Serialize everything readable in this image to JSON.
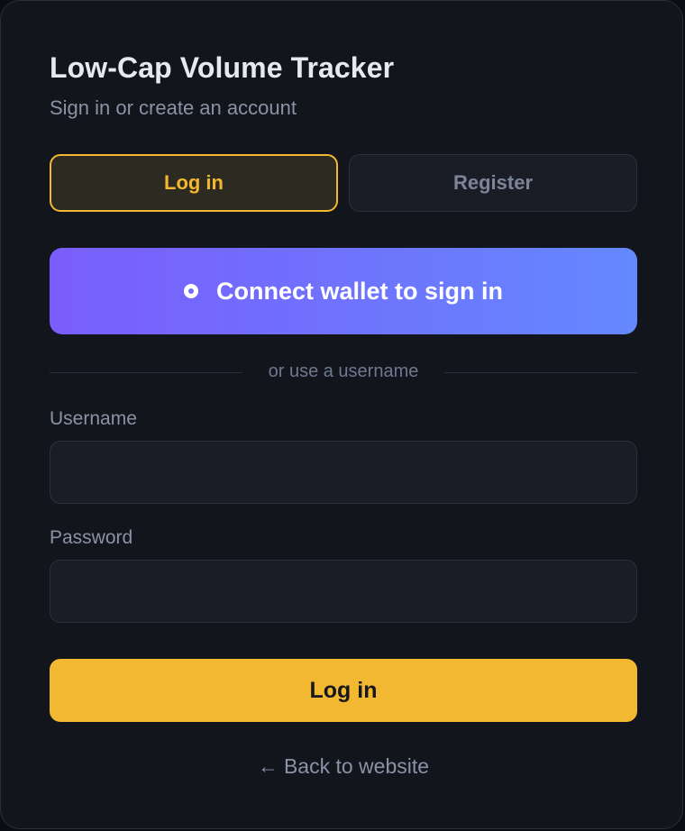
{
  "header": {
    "title": "Low-Cap Volume Tracker",
    "subtitle": "Sign in or create an account"
  },
  "tabs": [
    {
      "label": "Log in",
      "active": true
    },
    {
      "label": "Register",
      "active": false
    }
  ],
  "wallet": {
    "label": "Connect wallet to sign in",
    "icon": "wallet-dot-icon"
  },
  "divider": {
    "text": "or use a username"
  },
  "form": {
    "username_label": "Username",
    "username_value": "",
    "password_label": "Password",
    "password_value": "",
    "submit_label": "Log in"
  },
  "footer": {
    "back_arrow": "←",
    "back_label": "Back to website"
  },
  "colors": {
    "accent": "#f3b831",
    "wallet_gradient_start": "#7a5dfc",
    "wallet_gradient_end": "#6488fe",
    "background": "#12151c"
  }
}
